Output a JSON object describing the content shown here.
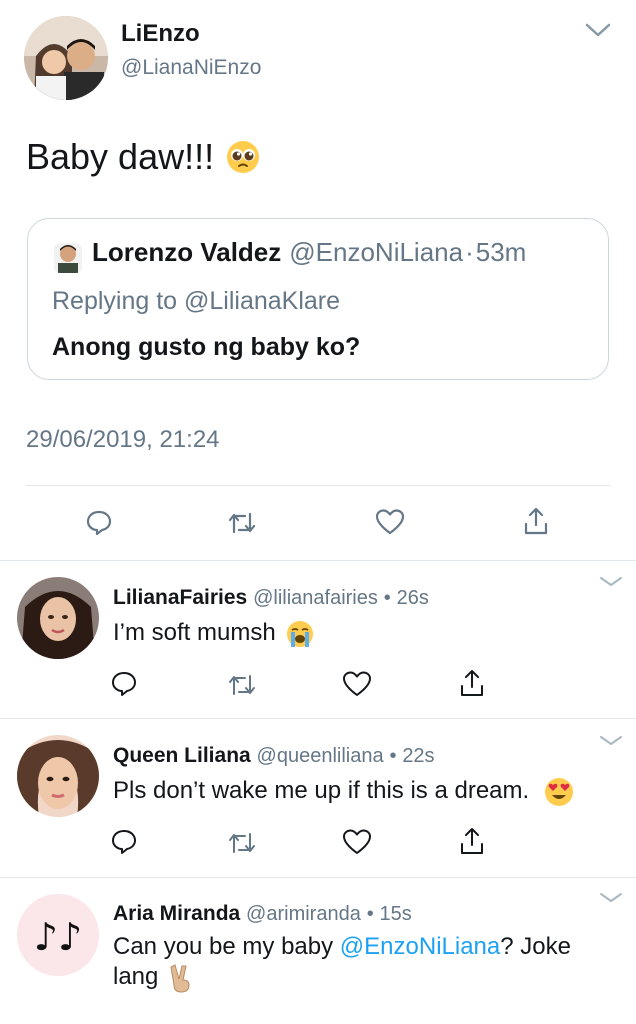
{
  "main_tweet": {
    "name": "LiEnzo",
    "handle": "@LianaNiEnzo",
    "text": "Baby daw!!!",
    "text_emoji": "pleading-face",
    "date": "29/06/2019, 21:24",
    "quoted": {
      "name": "Lorenzo Valdez",
      "handle": "@EnzoNiLiana",
      "separator": "·",
      "time": "53m",
      "replying_to": "Replying to @LilianaKlare",
      "text": "Anong gusto ng baby ko?"
    }
  },
  "replies": [
    {
      "name": "LilianaFairies",
      "handle": "@lilianafairies",
      "separator": "•",
      "time": "26s",
      "text": "I’m soft mumsh",
      "emoji": "loudly-crying-face"
    },
    {
      "name": "Queen Liliana",
      "handle": "@queenliliana",
      "separator": "•",
      "time": "22s",
      "text": "Pls don’t wake me up if this is a dream.",
      "emoji": "heart-eyes-face"
    },
    {
      "name": "Aria Miranda",
      "handle": "@arimiranda",
      "separator": "•",
      "time": "15s",
      "text_before": "Can you be my baby ",
      "mention": "@EnzoNiLiana",
      "text_after": "? Joke",
      "text_line2": "lang",
      "emoji": "victory-hand"
    }
  ],
  "icons": [
    "reply-icon",
    "retweet-icon",
    "like-icon",
    "share-icon",
    "chevron-down-icon"
  ],
  "colors": {
    "text": "#14171a",
    "secondary": "#657786",
    "link": "#1da1f2",
    "border": "#e1e8ed"
  }
}
